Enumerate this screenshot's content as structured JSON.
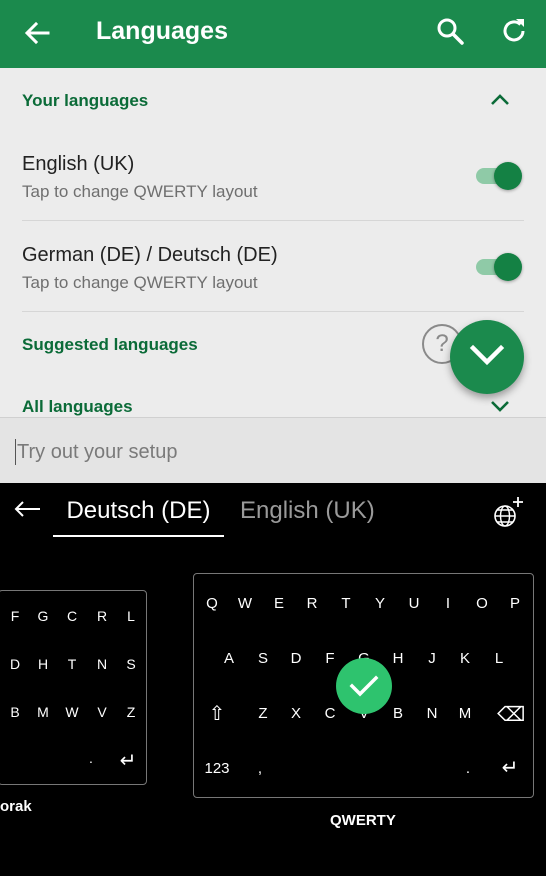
{
  "appbar": {
    "title": "Languages"
  },
  "sections": {
    "your_languages": "Your languages",
    "suggested_languages": "Suggested languages",
    "all_languages": "All languages"
  },
  "languages": [
    {
      "name": "English (UK)",
      "subtitle": "Tap to change QWERTY layout",
      "enabled": true
    },
    {
      "name": "German (DE) / Deutsch (DE)",
      "subtitle": "Tap to change QWERTY layout",
      "enabled": true
    }
  ],
  "help_symbol": "?",
  "try_input": {
    "placeholder": "Try out your setup"
  },
  "keyboard": {
    "tabs": {
      "active": "Deutsch (DE)",
      "inactive": "English (UK)"
    },
    "left_layout": {
      "label": "orak",
      "rows": [
        [
          "F",
          "G",
          "C",
          "R",
          "L"
        ],
        [
          "D",
          "H",
          "T",
          "N",
          "S"
        ],
        [
          "B",
          "M",
          "W",
          "V",
          "Z"
        ],
        [
          ".",
          "↵"
        ]
      ]
    },
    "right_layout": {
      "label": "QWERTY",
      "row1": [
        "Q",
        "W",
        "E",
        "R",
        "T",
        "Y",
        "U",
        "I",
        "O",
        "P"
      ],
      "row2": [
        "A",
        "S",
        "D",
        "F",
        "G",
        "H",
        "J",
        "K",
        "L"
      ],
      "row3": [
        "⇧",
        "Z",
        "X",
        "C",
        "V",
        "B",
        "N",
        "M",
        "⌫"
      ],
      "row4": [
        "123",
        ",",
        ".",
        "↵"
      ]
    }
  },
  "colors": {
    "primary": "#1b8a4d",
    "section_header": "#0b6b38",
    "check": "#2ec36e"
  }
}
